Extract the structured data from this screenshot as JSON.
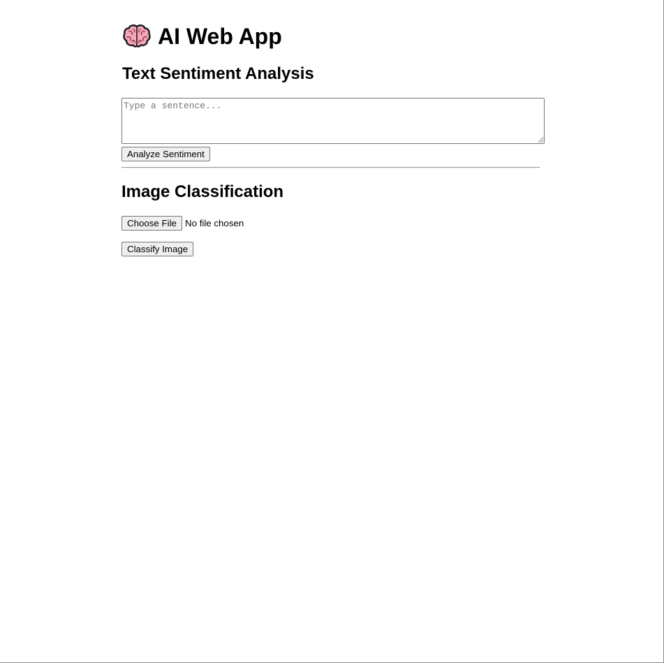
{
  "app": {
    "title": "AI Web App",
    "icon": "brain-icon"
  },
  "sentiment": {
    "heading": "Text Sentiment Analysis",
    "input_value": "",
    "input_placeholder": "Type a sentence...",
    "button_label": "Analyze Sentiment"
  },
  "image": {
    "heading": "Image Classification",
    "choose_file_label": "Choose File",
    "file_status": "No file chosen",
    "button_label": "Classify Image"
  },
  "colors": {
    "button_bg": "#efefef",
    "control_border": "#767676",
    "placeholder_text": "#757575",
    "brain_fill": "#f4a7b9",
    "brain_outline": "#1a1a1a"
  }
}
